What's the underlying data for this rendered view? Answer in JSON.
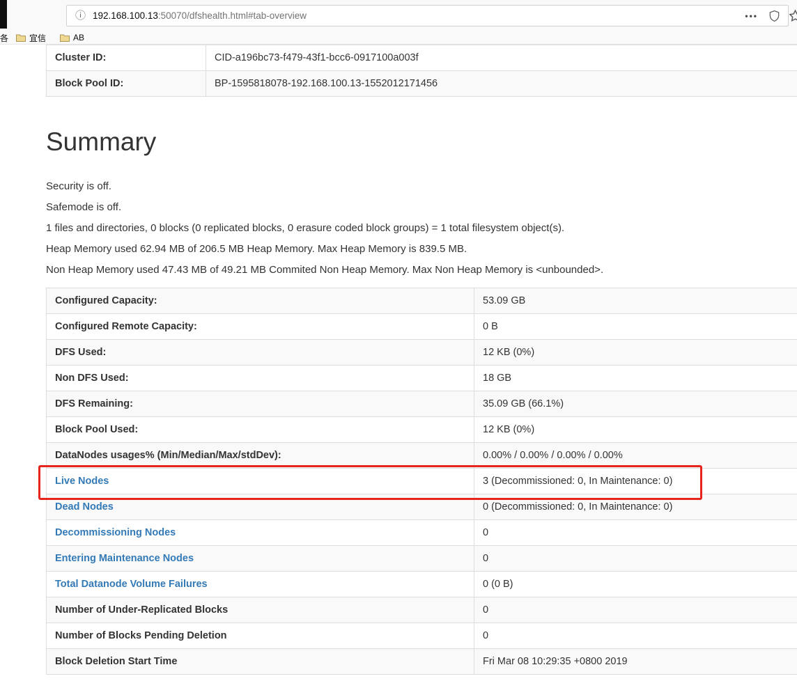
{
  "browser": {
    "info_glyph": "ⓘ",
    "url": {
      "host": "192.168.100.13",
      "rest": ":50070/dfshealth.html#tab-overview"
    },
    "page_actions_label": "•••",
    "bookmarks_bar": {
      "partial_item": "各",
      "items": [
        {
          "label": "宜信"
        },
        {
          "label": "AB"
        }
      ]
    }
  },
  "cluster_table": {
    "rows": [
      {
        "label": "Cluster ID:",
        "value": "CID-a196bc73-f479-43f1-bcc6-0917100a003f",
        "link": false
      },
      {
        "label": "Block Pool ID:",
        "value": "BP-1595818078-192.168.100.13-1552012171456",
        "link": false
      }
    ]
  },
  "summary": {
    "title": "Summary",
    "paragraphs": [
      "Security is off.",
      "Safemode is off.",
      "1 files and directories, 0 blocks (0 replicated blocks, 0 erasure coded block groups) = 1 total filesystem object(s).",
      "Heap Memory used 62.94 MB of 206.5 MB Heap Memory. Max Heap Memory is 839.5 MB.",
      "Non Heap Memory used 47.43 MB of 49.21 MB Commited Non Heap Memory. Max Non Heap Memory is <unbounded>."
    ],
    "table": {
      "rows": [
        {
          "label": "Configured Capacity:",
          "value": "53.09 GB",
          "link": false
        },
        {
          "label": "Configured Remote Capacity:",
          "value": "0 B",
          "link": false
        },
        {
          "label": "DFS Used:",
          "value": "12 KB (0%)",
          "link": false
        },
        {
          "label": "Non DFS Used:",
          "value": "18 GB",
          "link": false
        },
        {
          "label": "DFS Remaining:",
          "value": "35.09 GB (66.1%)",
          "link": false
        },
        {
          "label": "Block Pool Used:",
          "value": "12 KB (0%)",
          "link": false
        },
        {
          "label": "DataNodes usages% (Min/Median/Max/stdDev):",
          "value": "0.00% / 0.00% / 0.00% / 0.00%",
          "link": false
        },
        {
          "label": "Live Nodes",
          "value": "3 (Decommissioned: 0, In Maintenance: 0)",
          "link": true,
          "highlighted": true
        },
        {
          "label": "Dead Nodes",
          "value": "0 (Decommissioned: 0, In Maintenance: 0)",
          "link": true
        },
        {
          "label": "Decommissioning Nodes",
          "value": "0",
          "link": true
        },
        {
          "label": "Entering Maintenance Nodes",
          "value": "0",
          "link": true
        },
        {
          "label": "Total Datanode Volume Failures",
          "value": "0 (0 B)",
          "link": true
        },
        {
          "label": "Number of Under-Replicated Blocks",
          "value": "0",
          "link": false
        },
        {
          "label": "Number of Blocks Pending Deletion",
          "value": "0",
          "link": false
        },
        {
          "label": "Block Deletion Start Time",
          "value": "Fri Mar 08 10:29:35 +0800 2019",
          "link": false
        }
      ]
    }
  },
  "annotation": {
    "highlighted_row": "Live Nodes"
  },
  "colors": {
    "link": "#337ab7",
    "stripe": "#f9f9f9",
    "annotation_red": "#e8251c"
  }
}
